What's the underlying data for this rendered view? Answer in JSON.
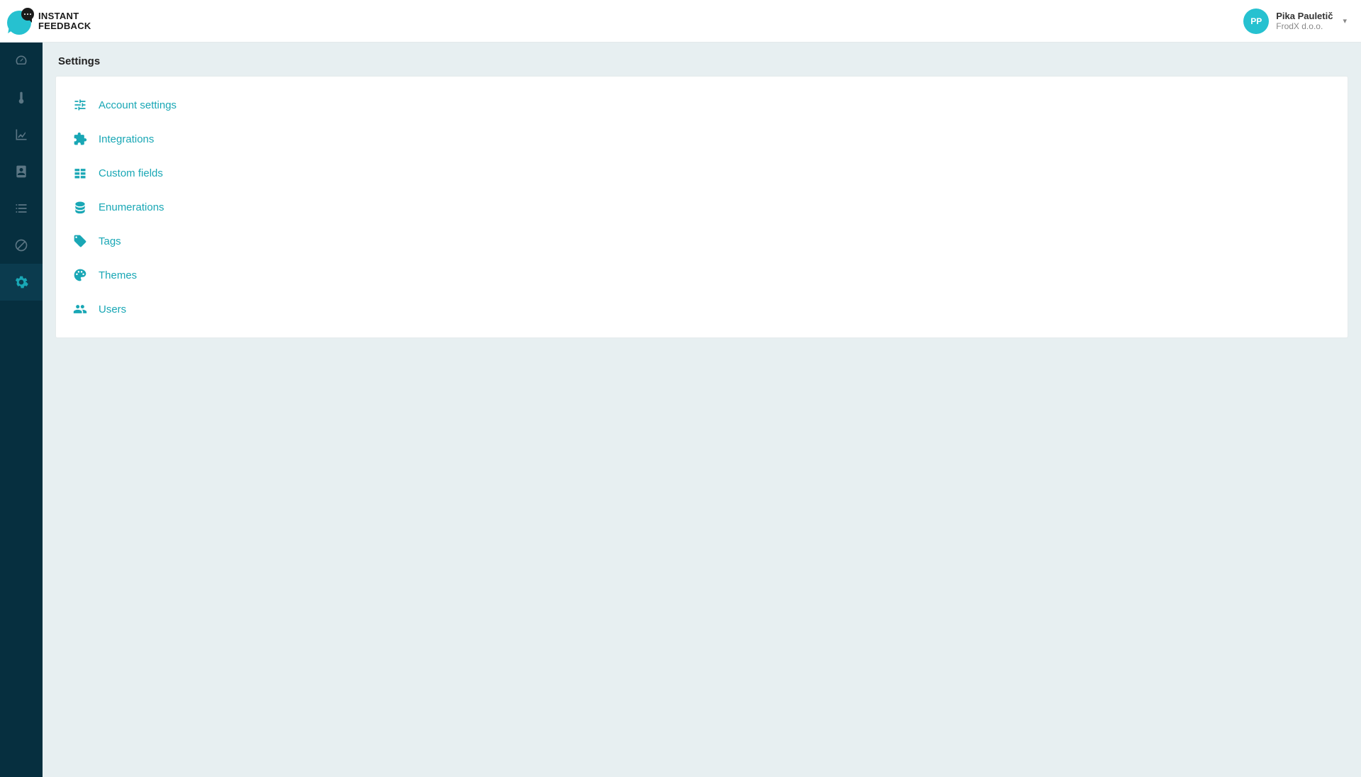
{
  "brand": {
    "line1": "INSTANT",
    "line2": "FEEDBACK"
  },
  "user": {
    "initials": "PP",
    "name": "Pika Pauletič",
    "org": "FrodX d.o.o."
  },
  "sidebar": {
    "items": [
      {
        "name": "dashboard",
        "icon": "gauge-icon",
        "active": false
      },
      {
        "name": "temperature",
        "icon": "thermometer-icon",
        "active": false
      },
      {
        "name": "analytics",
        "icon": "chart-line-icon",
        "active": false
      },
      {
        "name": "contacts",
        "icon": "address-book-icon",
        "active": false
      },
      {
        "name": "tasks",
        "icon": "checklist-icon",
        "active": false
      },
      {
        "name": "blocked",
        "icon": "ban-icon",
        "active": false
      },
      {
        "name": "settings",
        "icon": "gear-icon",
        "active": true
      }
    ]
  },
  "page": {
    "title": "Settings"
  },
  "settings_menu": {
    "items": [
      {
        "icon": "sliders-icon",
        "label": "Account settings",
        "name": "account-settings"
      },
      {
        "icon": "puzzle-icon",
        "label": "Integrations",
        "name": "integrations"
      },
      {
        "icon": "grid-icon",
        "label": "Custom fields",
        "name": "custom-fields"
      },
      {
        "icon": "database-icon",
        "label": "Enumerations",
        "name": "enumerations"
      },
      {
        "icon": "tags-icon",
        "label": "Tags",
        "name": "tags"
      },
      {
        "icon": "palette-icon",
        "label": "Themes",
        "name": "themes"
      },
      {
        "icon": "users-icon",
        "label": "Users",
        "name": "users"
      }
    ]
  },
  "colors": {
    "accent": "#19a7b5",
    "sidebar_bg": "#062f3f",
    "background": "#e7eff1"
  }
}
